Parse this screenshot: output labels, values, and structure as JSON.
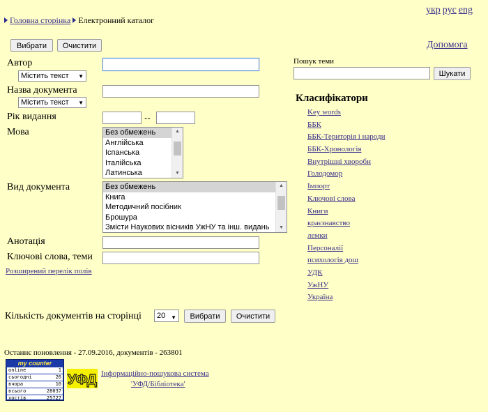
{
  "lang": [
    "укр",
    "рус",
    "eng"
  ],
  "breadcrumb": {
    "home": "Головна сторінка",
    "current": "Електронний каталог"
  },
  "top_buttons": {
    "select": "Вибрати",
    "clear": "Очистити"
  },
  "help": "Допомога",
  "form": {
    "author": {
      "label": "Автор",
      "value": "",
      "mode": "Містить текст"
    },
    "title": {
      "label": "Назва документа",
      "value": "",
      "mode": "Містить текст"
    },
    "year": {
      "label": "Рік видання",
      "separator": "--",
      "from": "",
      "to": ""
    },
    "language": {
      "label": "Мова",
      "options": [
        "Без обмежень",
        "Англійська",
        "Іспанська",
        "Італійська",
        "Латинська"
      ],
      "selected": "Без обмежень"
    },
    "doctype": {
      "label": "Вид документа",
      "options": [
        "Без обмежень",
        "Книга",
        "Методичний посібник",
        "Брошура",
        "Змісти Наукових вісників УжНУ та інш. видань"
      ],
      "selected": "Без обмежень"
    },
    "annotation": {
      "label": "Анотація",
      "value": ""
    },
    "keywords": {
      "label": "Ключові слова, теми",
      "value": ""
    },
    "extended": "Розширений перелік полів",
    "per_page_label": "Кількість документів на сторінці",
    "per_page_value": "20",
    "submit": "Вибрати",
    "reset": "Очистити"
  },
  "topic_search": {
    "label": "Пошук теми",
    "value": "",
    "button": "Шукати"
  },
  "classifiers": {
    "title": "Класифікатори",
    "items": [
      "Key words",
      "ББК",
      "ББК-Територія і народи",
      "ББК-Хронологія",
      "Внутрішні хвороби",
      "Голодомор",
      "Імпорт",
      "Ключові слова",
      "Книги",
      "краєзнавство",
      "лемки",
      "Персоналії",
      "психологія дош",
      "УДК",
      "УжНУ",
      "Україна"
    ]
  },
  "footer": {
    "updated": "Останнє поновлення - 27.09.2016, документів - 263801",
    "system_line1": "Інформаційно-пошукова система",
    "system_line2": "'УФД/Бібліотека'",
    "logo_text": "УФД",
    "counter": {
      "title": "my counter",
      "rows": [
        {
          "label": "online",
          "value": "1"
        },
        {
          "label": "сьогодні",
          "value": "26"
        },
        {
          "label": "вчора",
          "value": "10"
        },
        {
          "label": "всього",
          "value": "28037"
        },
        {
          "label": "хостів",
          "value": "25727"
        }
      ]
    }
  },
  "colors": {
    "background": "#ffffc8",
    "link": "#3a2f8c",
    "counter_bg": "#1a3aa8",
    "logo_yellow": "#f5f000"
  }
}
